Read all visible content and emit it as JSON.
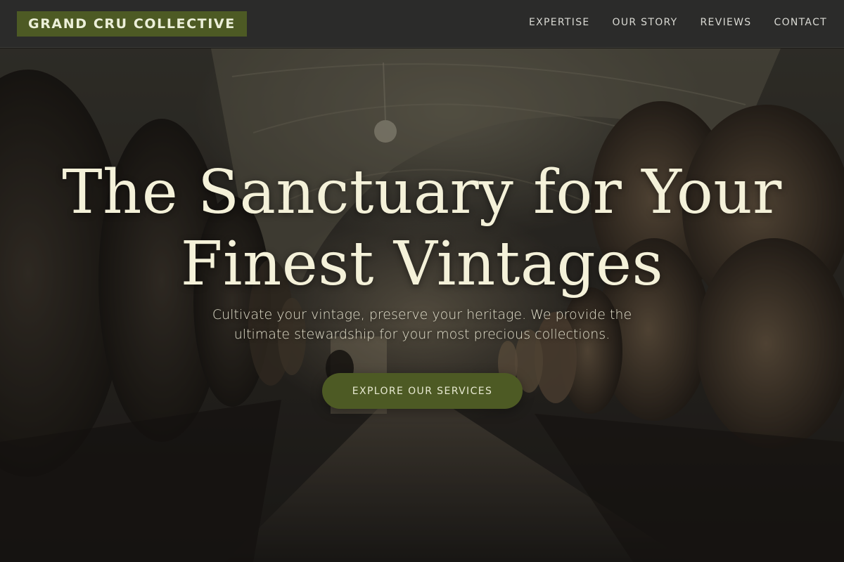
{
  "brand": {
    "name": "GRAND CRU COLLECTIVE"
  },
  "nav": {
    "items": [
      {
        "label": "EXPERTISE"
      },
      {
        "label": "OUR STORY"
      },
      {
        "label": "REVIEWS"
      },
      {
        "label": "CONTACT"
      }
    ]
  },
  "hero": {
    "title_line1": "The Sanctuary for Your",
    "title_line2": "Finest Vintages",
    "subtitle_line1": "Cultivate your vintage, preserve your heritage. We provide the",
    "subtitle_line2": "ultimate stewardship for your most precious collections.",
    "cta_label": "EXPLORE OUR SERVICES",
    "background": "wine-cellar-barrels-image"
  },
  "colors": {
    "accent_olive": "#4d5a24",
    "header_bg": "#2b2b2a",
    "title_cream": "#f4f1d9",
    "nav_text": "#d9d9d3"
  }
}
